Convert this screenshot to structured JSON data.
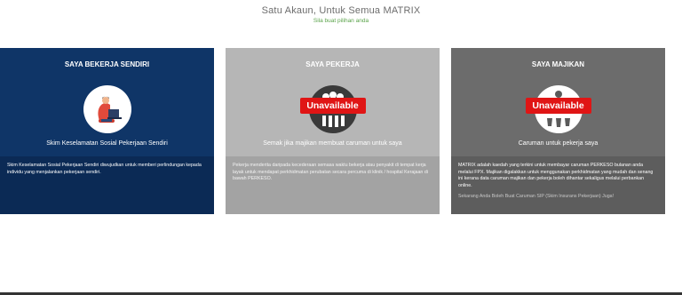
{
  "header": {
    "title": "Satu Akaun, Untuk Semua MATRIX",
    "subtitle": "Sila buat pilihan anda"
  },
  "cards": [
    {
      "heading": "SAYA BEKERJA SENDIRI",
      "icon": "person-laptop-icon",
      "tagline": "Skim Keselamatan Sosial Pekerjaan Sendiri",
      "description": "Skim Keselamatan Sosial Pekerjaan Sendiri diwujudkan untuk memberi perlindungan kepada individu yang menjalankan pekerjaan sendiri.",
      "color": "#0f3567"
    },
    {
      "heading": "SAYA PEKERJA",
      "icon": "workers-group-icon",
      "badge": "Unavailable",
      "tagline": "Semak jika majikan membuat caruman untuk saya",
      "description": "Pekerja menderita daripada kecederaan semasa waktu bekerja atau penyakit di tempat kerja layak untuk mendapat perkhidmatan perubatan secara percuma di klinik / hospital Kerajaan di bawah PERKESO.",
      "color": "#b6b6b6"
    },
    {
      "heading": "SAYA MAJIKAN",
      "icon": "employer-team-icon",
      "badge": "Unavailable",
      "tagline": "Caruman untuk pekerja saya",
      "description": "MATRIX adalah kaedah yang terkini untuk membayar caruman PERKESO bulanan anda melalui FPX. Majikan digalakkan untuk menggunakan perkhidmatan yang mudah dan senang ini kerana data caruman majikan dan pekerja boleh dihantar sekaligus melalui perbankan online.",
      "note": "Sekarang Anda Boleh Buat Caruman SIP (Skim Insurans Pekerjaan) Juga!",
      "color": "#6c6c6c"
    }
  ]
}
